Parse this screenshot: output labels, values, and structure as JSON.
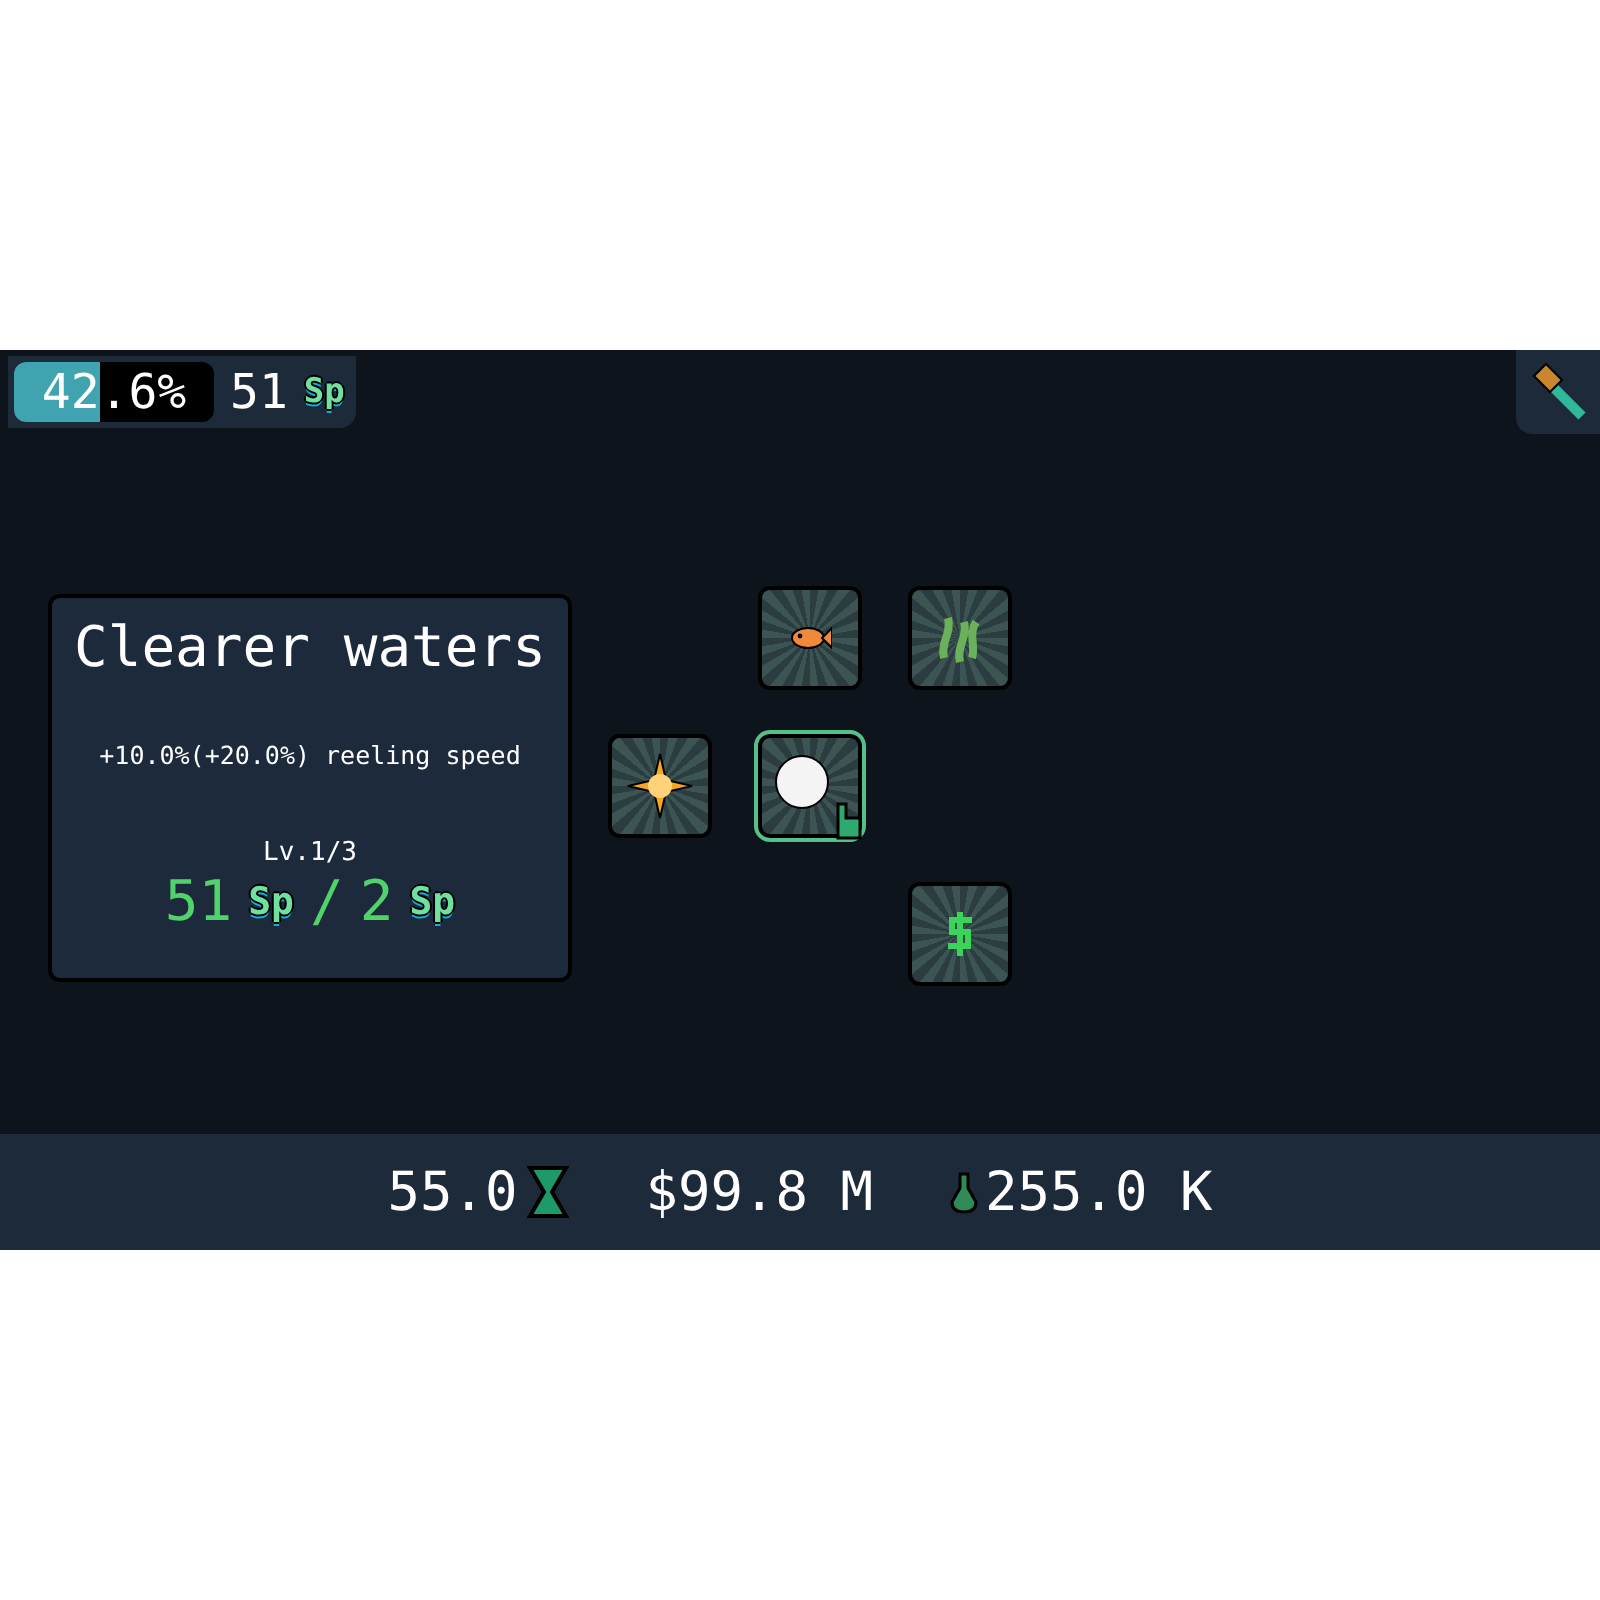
{
  "progress": {
    "text": "42.6%",
    "level": 0.426
  },
  "skill_points": {
    "amount": "51",
    "unit": "Sp"
  },
  "info_card": {
    "title": "Clearer waters",
    "description": "+10.0%(+20.0%) reeling speed",
    "level_text": "Lv.1/3",
    "cost": {
      "have": "51",
      "have_unit": "Sp",
      "separator": "/",
      "need": "2",
      "need_unit": "Sp"
    }
  },
  "skill_nodes": [
    {
      "kind": "fish",
      "selected": false
    },
    {
      "kind": "seaweed",
      "selected": false
    },
    {
      "kind": "sparkle",
      "selected": false
    },
    {
      "kind": "pearl",
      "selected": true
    },
    {
      "kind": "money",
      "selected": false
    }
  ],
  "bottom_bar": [
    {
      "kind": "time",
      "value": "55.0"
    },
    {
      "kind": "money",
      "value": "$99.8 M"
    },
    {
      "kind": "potion",
      "value": "255.0 K"
    }
  ]
}
